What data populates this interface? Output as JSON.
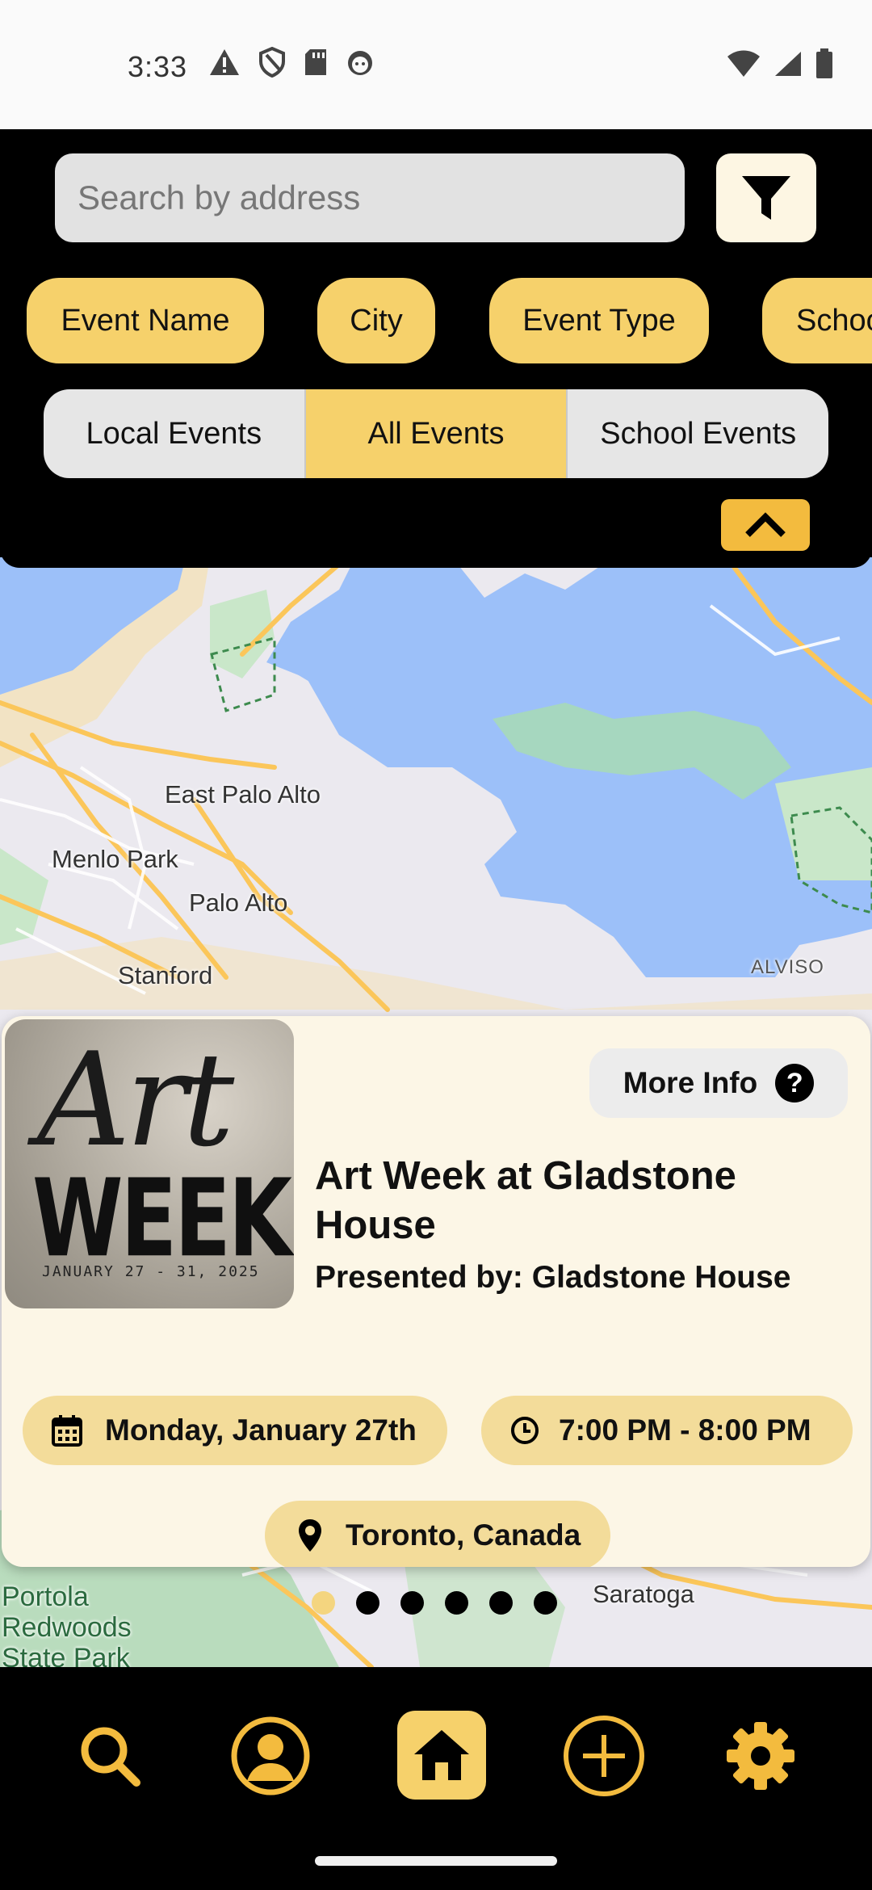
{
  "status_bar": {
    "time": "3:33",
    "left_icons": [
      "warning-icon",
      "shield-icon",
      "sd-card-icon",
      "notification-face-icon"
    ],
    "right_icons": [
      "wifi-icon",
      "cell-signal-icon",
      "battery-icon"
    ]
  },
  "search": {
    "placeholder": "Search by address",
    "filter_icon": "filter-icon"
  },
  "filter_chips": [
    "Event Name",
    "City",
    "Event Type",
    "School"
  ],
  "segments": {
    "items": [
      "Local Events",
      "All Events",
      "School Events"
    ],
    "selected": "All Events"
  },
  "collapse_icon": "chevron-up-icon",
  "map": {
    "labels": {
      "east_palo_alto": "East Palo Alto",
      "menlo_park": "Menlo Park",
      "palo_alto": "Palo Alto",
      "stanford": "Stanford",
      "alviso": "ALVISO",
      "saratoga": "Saratoga",
      "portola": "Portola\nRedwoods\nState Park"
    }
  },
  "event": {
    "image": {
      "script_text": "Art",
      "headline": "WEEK",
      "dates": "JANUARY 27 - 31, 2025"
    },
    "more_info_label": "More Info",
    "more_info_icon": "help-icon",
    "title": "Art Week at Gladstone House",
    "presenter": "Presented by: Gladstone House",
    "date": "Monday, January 27th",
    "time": "7:00 PM - 8:00 PM",
    "location": "Toronto, Canada"
  },
  "pager": {
    "count": 6,
    "active_index": 0
  },
  "bottom_nav": {
    "items": [
      "search-icon",
      "profile-icon",
      "home-icon",
      "add-icon",
      "settings-icon"
    ],
    "active": "home-icon"
  },
  "colors": {
    "accent": "#f6d16b",
    "accent_dark": "#f3bb3e",
    "card_bg": "#fcf6e6",
    "pill_bg": "#f3dc9a",
    "background": "#000000"
  }
}
